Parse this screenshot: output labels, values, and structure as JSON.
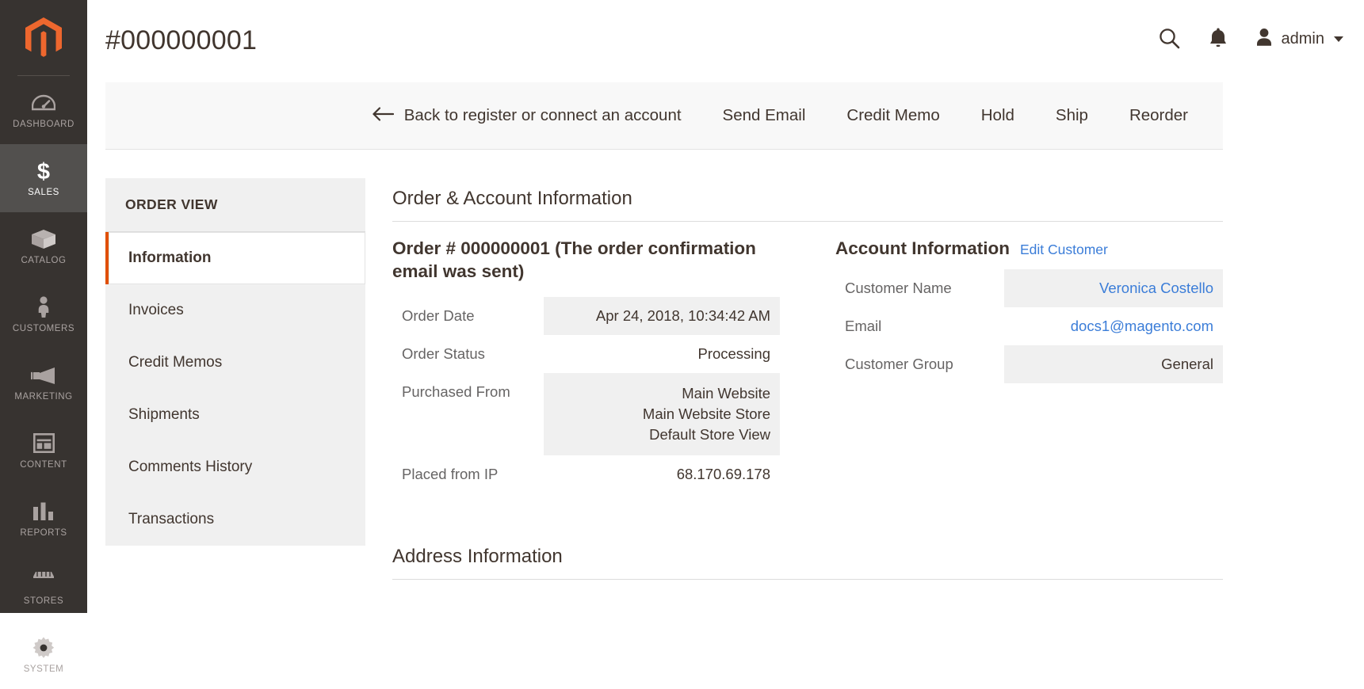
{
  "admin_nav": {
    "logo_name": "magento-logo",
    "items": [
      {
        "label": "DASHBOARD",
        "icon": "dashboard-icon",
        "active": false
      },
      {
        "label": "SALES",
        "icon": "sales-icon",
        "active": true
      },
      {
        "label": "CATALOG",
        "icon": "catalog-icon",
        "active": false
      },
      {
        "label": "CUSTOMERS",
        "icon": "customers-icon",
        "active": false
      },
      {
        "label": "MARKETING",
        "icon": "marketing-icon",
        "active": false
      },
      {
        "label": "CONTENT",
        "icon": "content-icon",
        "active": false
      },
      {
        "label": "REPORTS",
        "icon": "reports-icon",
        "active": false
      },
      {
        "label": "STORES",
        "icon": "stores-icon",
        "active": false
      },
      {
        "label": "SYSTEM",
        "icon": "system-icon",
        "active": false
      }
    ]
  },
  "header": {
    "title": "#000000001",
    "search_icon": "search-icon",
    "notifications_icon": "bell-icon",
    "user_avatar_icon": "user-avatar-icon",
    "user_name": "admin",
    "caret_icon": "chevron-down-icon"
  },
  "page_actions": {
    "back_label": "Back to register or connect an account",
    "back_icon": "arrow-left-icon",
    "buttons": [
      {
        "label": "Send Email"
      },
      {
        "label": "Credit Memo"
      },
      {
        "label": "Hold"
      },
      {
        "label": "Ship"
      },
      {
        "label": "Reorder"
      }
    ]
  },
  "order_view": {
    "title": "ORDER VIEW",
    "tabs": [
      {
        "label": "Information",
        "active": true
      },
      {
        "label": "Invoices",
        "active": false
      },
      {
        "label": "Credit Memos",
        "active": false
      },
      {
        "label": "Shipments",
        "active": false
      },
      {
        "label": "Comments History",
        "active": false
      },
      {
        "label": "Transactions",
        "active": false
      }
    ]
  },
  "main": {
    "order_account_heading": "Order & Account Information",
    "order_block": {
      "title": "Order # 000000001 (The order confirmation email was sent)",
      "rows": [
        {
          "label": "Order Date",
          "value": "Apr 24, 2018, 10:34:42 AM"
        },
        {
          "label": "Order Status",
          "value": "Processing"
        },
        {
          "label": "Purchased From",
          "value": [
            "Main Website",
            "Main Website Store",
            "Default Store View"
          ]
        },
        {
          "label": "Placed from IP",
          "value": "68.170.69.178"
        }
      ]
    },
    "account_block": {
      "title": "Account Information",
      "edit_link": "Edit Customer",
      "rows": [
        {
          "label": "Customer Name",
          "value": "Veronica Costello",
          "link": true
        },
        {
          "label": "Email",
          "value": "docs1@magento.com",
          "link": true
        },
        {
          "label": "Customer Group",
          "value": "General",
          "link": false
        }
      ]
    },
    "address_heading": "Address Information"
  },
  "colors": {
    "brand_orange": "#e04f00",
    "nav_background": "#373330",
    "link_blue": "#3b7dd8",
    "text_dark": "#41362f"
  }
}
